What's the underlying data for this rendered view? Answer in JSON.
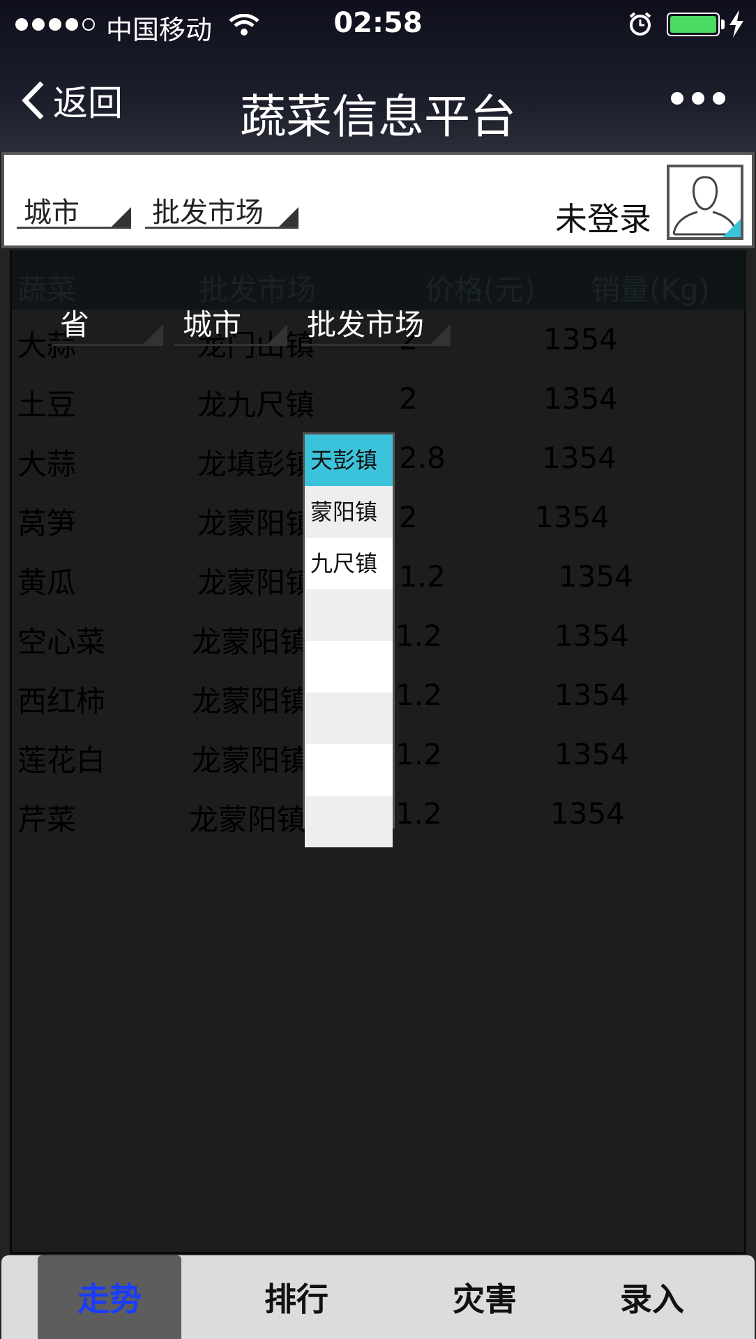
{
  "status": {
    "carrier": "中国移动",
    "time": "02:58"
  },
  "nav": {
    "back_label": "返回",
    "title": "蔬菜信息平台"
  },
  "filters": {
    "city_label": "城市",
    "market_label": "批发市场",
    "login_text": "未登录"
  },
  "table": {
    "headers": [
      "蔬菜",
      "批发市场",
      "价格(元)",
      "销量(Kg)"
    ],
    "rows": [
      [
        "大蒜",
        "龙门山镇",
        "2",
        "1354"
      ],
      [
        "土豆",
        "龙九尺镇",
        "2",
        "1354"
      ],
      [
        "大蒜",
        "龙填彭镇",
        "2.8",
        "1354"
      ],
      [
        "莴笋",
        "龙蒙阳镇",
        "2",
        "1354"
      ],
      [
        "黄瓜",
        "龙蒙阳镇",
        "1.2",
        "1354"
      ],
      [
        "空心菜",
        "龙蒙阳镇",
        "1.2",
        "1354"
      ],
      [
        "西红柿",
        "龙蒙阳镇",
        "1.2",
        "1354"
      ],
      [
        "莲花白",
        "龙蒙阳镇",
        "1.2",
        "1354"
      ],
      [
        "芹菜",
        "龙蒙阳镇",
        "1.2",
        "1354"
      ]
    ]
  },
  "overlay": {
    "province_label": "省",
    "city_label": "城市",
    "market_label": "批发市场"
  },
  "dropdown": {
    "options": [
      "天彭镇",
      "蒙阳镇",
      "九尺镇",
      "",
      "",
      "",
      "",
      ""
    ]
  },
  "tabs": [
    "走势",
    "排行",
    "灾害",
    "录入"
  ],
  "colors": {
    "accent": "#3cc3dc",
    "active_tab_text": "#1a3cff",
    "battery": "#4cd964"
  }
}
